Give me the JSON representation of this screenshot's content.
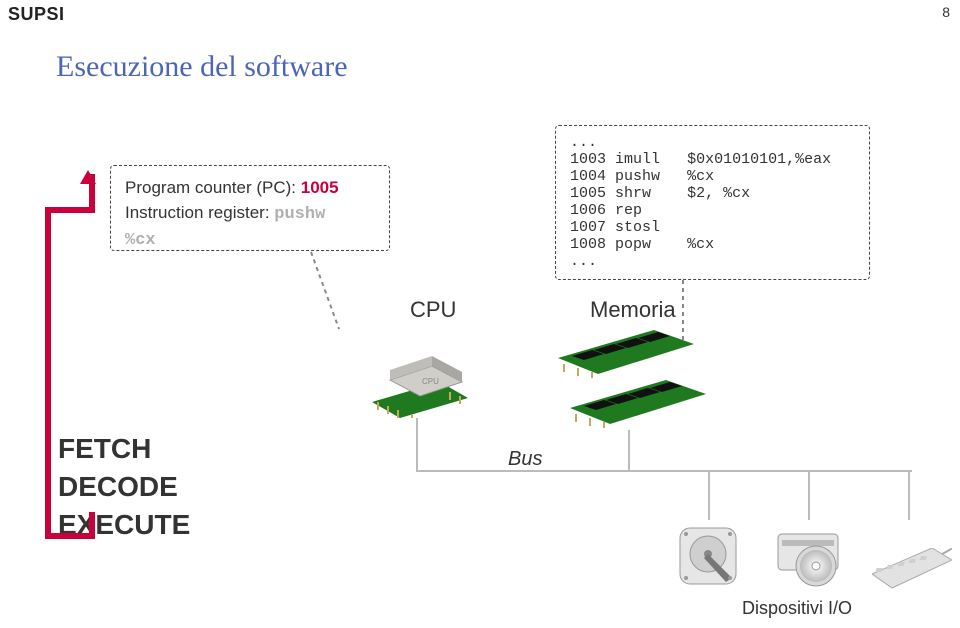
{
  "brand": "SUPSI",
  "page_number": "8",
  "title": "Esecuzione del software",
  "cpu_box": {
    "pc_label": "Program counter (PC): ",
    "pc_value": "1005",
    "ir_label": "Instruction register: ",
    "ir_value": "pushw",
    "ir_reg": "%cx"
  },
  "mem_box": {
    "lines": [
      {
        "addr": "...",
        "op": "",
        "args": ""
      },
      {
        "addr": "1003",
        "op": "imull",
        "args": "$0x01010101,%eax"
      },
      {
        "addr": "1004",
        "op": "pushw",
        "args": "%cx"
      },
      {
        "addr": "1005",
        "op": "shrw",
        "args": "$2, %cx"
      },
      {
        "addr": "1006",
        "op": "rep",
        "args": ""
      },
      {
        "addr": "1007",
        "op": "stosl",
        "args": ""
      },
      {
        "addr": "1008",
        "op": "popw",
        "args": "%cx"
      },
      {
        "addr": "...",
        "op": "",
        "args": ""
      }
    ]
  },
  "labels": {
    "cpu": "CPU",
    "memory": "Memoria",
    "bus": "Bus",
    "io": "Dispositivi I/O"
  },
  "fde": {
    "line1": "FETCH",
    "line2": "DECODE",
    "line3": "EXECUTE"
  },
  "icons": {
    "cpu": "cpu-chip-icon",
    "ram": "ram-stick-icon",
    "hdd": "hdd-icon",
    "cd": "optical-drive-icon",
    "keyboard": "keyboard-icon",
    "loop_arrow": "loop-arrow-icon"
  },
  "colors": {
    "accent_blue": "#4a66b5",
    "accent_red": "#c8003c",
    "chip_green": "#1f7a1f",
    "chip_gray": "#b6b6b6",
    "bus_gray": "#bbbbbb"
  }
}
